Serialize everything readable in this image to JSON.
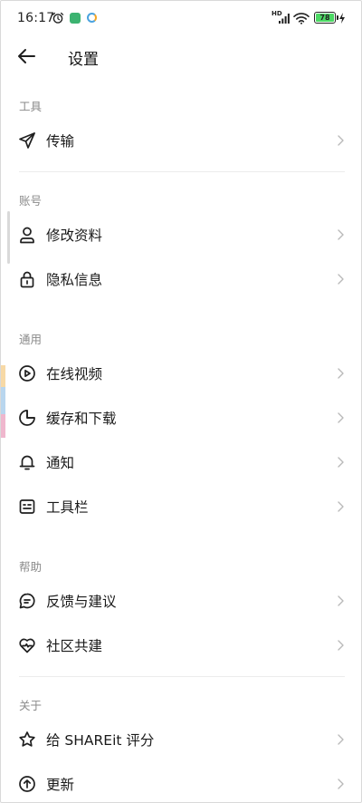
{
  "status_bar": {
    "time": "16:17",
    "battery_level": "78",
    "network_label": "HD",
    "icons": [
      "alarm-icon",
      "app-notification-icon",
      "sync-icon",
      "signal-icon",
      "wifi-icon",
      "battery-icon",
      "charging-icon"
    ]
  },
  "header": {
    "title": "设置",
    "back_icon": "arrow-left-icon"
  },
  "sections": {
    "tools": {
      "label": "工具",
      "items": [
        {
          "label": "传输",
          "icon": "send-icon"
        }
      ]
    },
    "account": {
      "label": "账号",
      "items": [
        {
          "label": "修改资料",
          "icon": "user-icon"
        },
        {
          "label": "隐私信息",
          "icon": "lock-icon"
        }
      ]
    },
    "general": {
      "label": "通用",
      "items": [
        {
          "label": "在线视频",
          "icon": "play-circle-icon"
        },
        {
          "label": "缓存和下载",
          "icon": "pie-chart-icon"
        },
        {
          "label": "通知",
          "icon": "bell-icon"
        },
        {
          "label": "工具栏",
          "icon": "toolbar-icon"
        }
      ]
    },
    "help": {
      "label": "帮助",
      "items": [
        {
          "label": "反馈与建议",
          "icon": "chat-icon"
        },
        {
          "label": "社区共建",
          "icon": "heart-pulse-icon"
        }
      ]
    },
    "about": {
      "label": "关于",
      "items": [
        {
          "label": "给 SHAREit 评分",
          "icon": "star-icon"
        },
        {
          "label": "更新",
          "icon": "arrow-up-circle-icon"
        }
      ]
    }
  },
  "colors": {
    "text": "#1a1a1a",
    "section_label": "#8a8a8a",
    "chevron": "#b9b9b9",
    "divider": "#ececec",
    "battery_fill": "#4cd964"
  }
}
